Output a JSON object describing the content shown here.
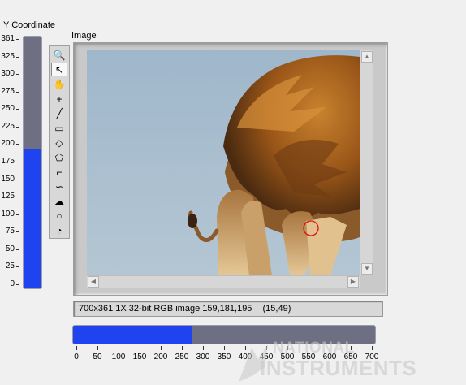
{
  "y_coordinate": {
    "title": "Y Coordinate",
    "scale_labels": [
      "361",
      "325",
      "300",
      "275",
      "250",
      "225",
      "200",
      "175",
      "150",
      "125",
      "100",
      "75",
      "50",
      "25",
      "0"
    ],
    "value": 200,
    "max": 361,
    "fill_color": "#1f44ef",
    "track_color": "#6e6f82"
  },
  "image_display": {
    "title": "Image",
    "tools": [
      {
        "name": "zoom-tool",
        "glyph": "🔍"
      },
      {
        "name": "pointer-tool",
        "glyph": "↖"
      },
      {
        "name": "pan-tool",
        "glyph": "✋"
      },
      {
        "name": "point-tool",
        "glyph": "+"
      },
      {
        "name": "line-tool",
        "glyph": "╱"
      },
      {
        "name": "rectangle-tool",
        "glyph": "▭"
      },
      {
        "name": "rotated-rectangle-tool",
        "glyph": "◇"
      },
      {
        "name": "polygon-tool",
        "glyph": "⬠"
      },
      {
        "name": "broken-line-tool",
        "glyph": "⌐"
      },
      {
        "name": "freehand-tool",
        "glyph": "∽"
      },
      {
        "name": "freehand-region-tool",
        "glyph": "☁"
      },
      {
        "name": "oval-tool",
        "glyph": "○"
      },
      {
        "name": "annulus-tool",
        "glyph": "◔"
      }
    ],
    "active_tool": 1,
    "picture": "lion-photo",
    "info_bar": {
      "image_info": "700x361 1X 32-bit RGB image 159,181,195",
      "cursor_position": "(15,49)"
    }
  },
  "x_coordinate": {
    "scale_labels": [
      "0",
      "50",
      "100",
      "150",
      "200",
      "250",
      "300",
      "350",
      "400",
      "450",
      "500",
      "550",
      "600",
      "650",
      "700"
    ],
    "value": 275,
    "max": 700,
    "fill_color": "#1f44ef",
    "track_color": "#6e6f82"
  },
  "watermark": {
    "line1": "NATIONAL",
    "line2": "INSTRUMENTS"
  },
  "colors": {
    "background": "#f0f0f0",
    "sky": "#a9bfd0",
    "mane": "#b8702a"
  }
}
